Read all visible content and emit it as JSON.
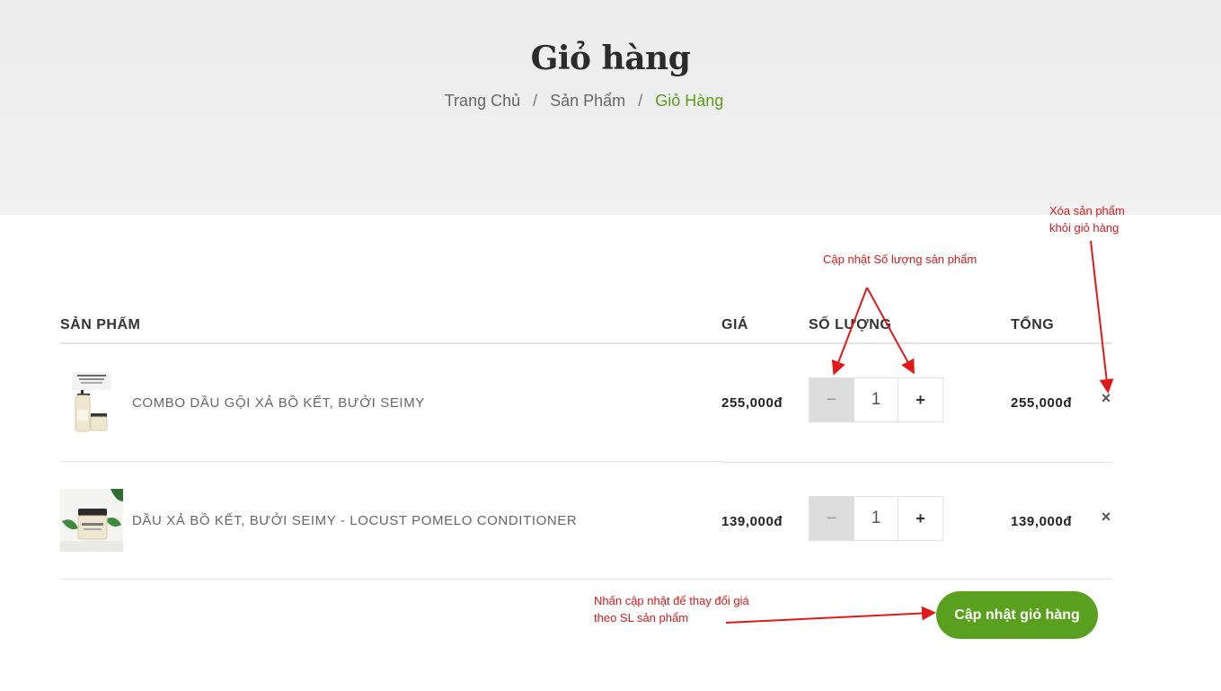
{
  "hero": {
    "title": "Giỏ hàng",
    "breadcrumb": [
      {
        "label": "Trang Chủ"
      },
      {
        "label": "Sản Phẩm"
      },
      {
        "label": "Giỏ Hàng"
      }
    ],
    "separator": "/"
  },
  "table": {
    "headers": {
      "product": "SẢN PHẨM",
      "price": "GIÁ",
      "quantity": "SỐ LƯỢNG",
      "total": "TỔNG"
    },
    "rows": [
      {
        "name": "COMBO DẦU GỘI XẢ BỒ KẾT, BƯỞI SEIMY",
        "price": "255,000đ",
        "quantity": "1",
        "total": "255,000đ",
        "minus": "−",
        "plus": "+",
        "remove": "×"
      },
      {
        "name": "DẦU XẢ BỒ KẾT, BƯỞI SEIMY - LOCUST POMELO CONDITIONER",
        "price": "139,000đ",
        "quantity": "1",
        "total": "139,000đ",
        "minus": "−",
        "plus": "+",
        "remove": "×"
      }
    ]
  },
  "actions": {
    "update_cart": "Cập nhật giỏ hàng"
  },
  "annotations": {
    "quantity_note": "Cập nhật Số lượng sản phẩm",
    "remove_note_line1": "Xóa sản phẩm",
    "remove_note_line2": "khỏi giỏ hàng",
    "update_note_line1": "Nhấn cập nhật để thay đổi giá",
    "update_note_line2": "theo SL sản phẩm"
  },
  "colors": {
    "accent": "#5aa01f",
    "annotation": "#d61a1a"
  }
}
